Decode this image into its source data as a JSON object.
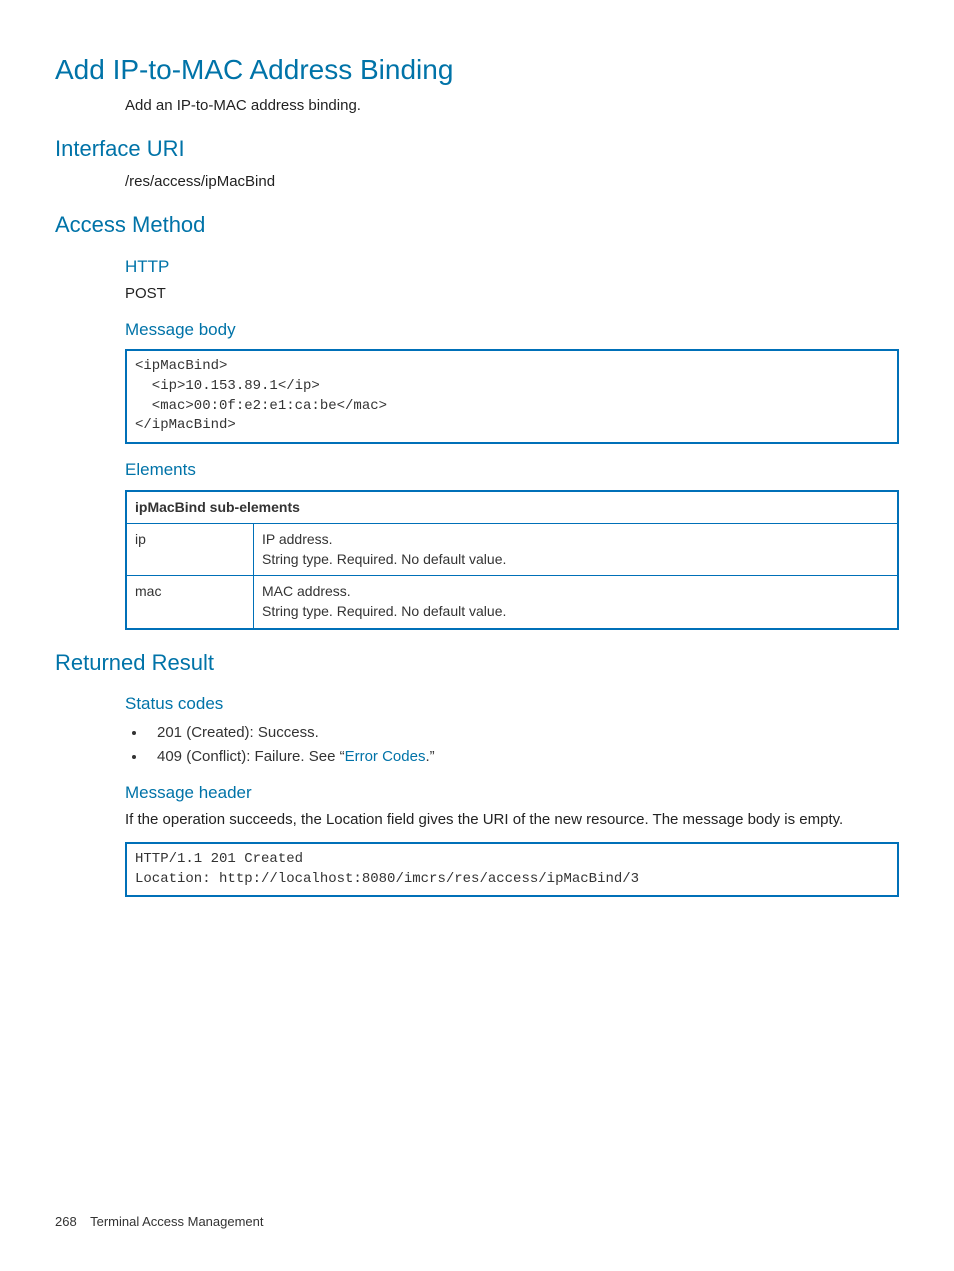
{
  "title": "Add IP-to-MAC Address Binding",
  "intro": "Add an IP-to-MAC address binding.",
  "interface_uri_heading": "Interface URI",
  "interface_uri": "/res/access/ipMacBind",
  "access_method_heading": "Access Method",
  "http_heading": "HTTP",
  "http_method": "POST",
  "message_body_heading": "Message body",
  "message_body_code": "<ipMacBind>\n  <ip>10.153.89.1</ip>\n  <mac>00:0f:e2:e1:ca:be</mac>\n</ipMacBind>",
  "elements_heading": "Elements",
  "elements_table": {
    "header": "ipMacBind sub-elements",
    "rows": [
      {
        "name": "ip",
        "desc1": "IP address.",
        "desc2": "String type. Required. No default value."
      },
      {
        "name": "mac",
        "desc1": "MAC address.",
        "desc2": "String type. Required. No default value."
      }
    ]
  },
  "returned_result_heading": "Returned Result",
  "status_codes_heading": "Status codes",
  "status_codes": {
    "item1": "201 (Created): Success.",
    "item2_prefix": "409 (Conflict): Failure. See “",
    "item2_link": "Error Codes",
    "item2_suffix": ".”"
  },
  "message_header_heading": "Message header",
  "message_header_text": "If the operation succeeds, the Location field gives the URI of the new resource. The message body is empty.",
  "message_header_code": "HTTP/1.1 201 Created\nLocation: http://localhost:8080/imcrs/res/access/ipMacBind/3",
  "footer": {
    "page": "268",
    "section": "Terminal Access Management"
  }
}
